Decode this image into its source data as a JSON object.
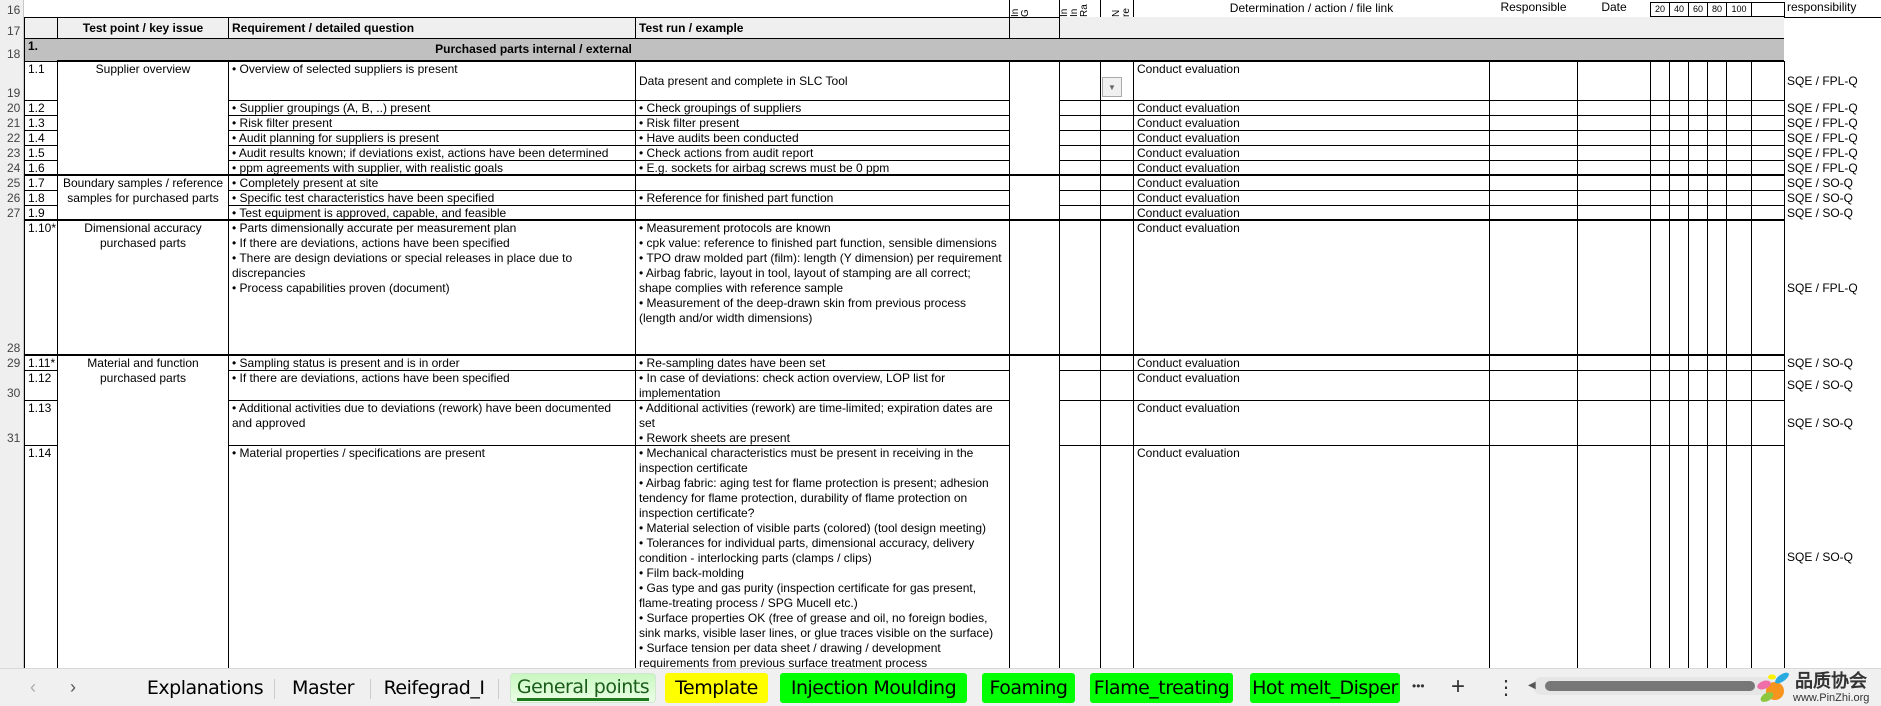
{
  "row_numbers": [
    "16",
    "17",
    "18",
    "19",
    "20",
    "21",
    "22",
    "23",
    "24",
    "25",
    "26",
    "27",
    "28",
    "29",
    "30",
    "31",
    ""
  ],
  "header": {
    "test_point": "Test point / key issue",
    "requirement": "Requirement / detailed question",
    "test_run": "Test run / example",
    "col_e": "In G",
    "col_f": "In In Ra",
    "col_g": "N re",
    "determination": "Determination / action / file link",
    "responsible": "Responsible",
    "date": "Date",
    "pct": [
      "20",
      "40",
      "60",
      "80",
      "100"
    ],
    "responsibility": "responsibility"
  },
  "section": {
    "number": "1.",
    "title": "Purchased parts internal / external"
  },
  "groups": {
    "g1": "Supplier overview",
    "g2": "Boundary samples / reference samples for purchased parts",
    "g3": "Dimensional accuracy purchased parts",
    "g4": "Material and function purchased parts"
  },
  "rows": [
    {
      "id": "1.1",
      "req": "• Overview of selected suppliers is present",
      "test": "Data present and complete in SLC Tool",
      "action": "Conduct evaluation",
      "resp": "SQE / FPL-Q"
    },
    {
      "id": "1.2",
      "req": "• Supplier groupings (A, B, ..) present",
      "test": "• Check groupings of suppliers",
      "action": "Conduct evaluation",
      "resp": "SQE / FPL-Q"
    },
    {
      "id": "1.3",
      "req": "• Risk filter present",
      "test": "• Risk filter present",
      "action": "Conduct evaluation",
      "resp": "SQE / FPL-Q"
    },
    {
      "id": "1.4",
      "req": "• Audit planning for suppliers is present",
      "test": "• Have audits been conducted",
      "action": "Conduct evaluation",
      "resp": "SQE / FPL-Q"
    },
    {
      "id": "1.5",
      "req": "• Audit results known; if deviations exist, actions have been determined",
      "test": "• Check actions from audit report",
      "action": "Conduct evaluation",
      "resp": "SQE / FPL-Q"
    },
    {
      "id": "1.6",
      "req": "• ppm agreements with supplier, with realistic goals",
      "test": "• E.g. sockets for airbag screws must be 0 ppm",
      "action": "Conduct evaluation",
      "resp": "SQE / FPL-Q"
    },
    {
      "id": "1.7",
      "req": "• Completely present at site",
      "test": "",
      "action": "Conduct evaluation",
      "resp": "SQE / SO-Q"
    },
    {
      "id": "1.8",
      "req": "• Specific test characteristics have been specified",
      "test": "• Reference for finished part function",
      "action": "Conduct evaluation",
      "resp": "SQE / SO-Q"
    },
    {
      "id": "1.9",
      "req": "• Test equipment is approved, capable, and feasible",
      "test": "",
      "action": "Conduct evaluation",
      "resp": "SQE / SO-Q"
    },
    {
      "id": "1.10*",
      "req": "• Parts dimensionally accurate per measurement plan\n• If there are deviations, actions have been specified\n• There are design deviations or special releases in place due to discrepancies\n• Process capabilities proven (document)",
      "test": "• Measurement protocols are known\n• cpk value: reference to finished part function,  sensible dimensions\n• TPO draw molded part (film): length (Y dimension) per requirement\n• Airbag fabric, layout in tool, layout of stamping are all correct; shape complies with reference sample\n• Measurement of the deep-drawn skin from previous process (length and/or width dimensions)",
      "action": "Conduct evaluation",
      "resp": "SQE / FPL-Q"
    },
    {
      "id": "1.11*",
      "req": "• Sampling status is present and is in order",
      "test": "• Re-sampling dates have been set",
      "action": "Conduct evaluation",
      "resp": "SQE / SO-Q"
    },
    {
      "id": "1.12",
      "req": "• If there are deviations, actions have been specified",
      "test": "• In case of deviations: check action overview, LOP list for implementation",
      "action": "Conduct evaluation",
      "resp": "SQE / SO-Q"
    },
    {
      "id": "1.13",
      "req": "• Additional activities due to deviations (rework) have been documented and approved",
      "test": "• Additional activities (rework) are time-limited; expiration dates are set\n• Rework sheets are present",
      "action": "Conduct evaluation",
      "resp": "SQE / SO-Q"
    },
    {
      "id": "1.14",
      "req": "• Material properties / specifications are present",
      "test": "• Mechanical characteristics must be present in receiving in the inspection certificate\n• Airbag fabric: aging test for flame protection is present; adhesion tendency for flame protection, durability of flame protection on inspection certificate?\n• Material selection of visible parts (colored)  (tool design meeting)\n• Tolerances for individual parts, dimensional accuracy, delivery condition - interlocking parts (clamps / clips)\n• Film back-molding\n• Gas type and gas purity  (inspection certificate for gas present, flame-treating process / SPG Mucell etc.)\n• Surface properties OK (free of grease and oil, no foreign bodies, sink marks, visible laser lines, or glue traces visible on the surface)\n• Surface tension per data sheet / drawing / development requirements from previous surface treatment process",
      "action": "Conduct evaluation",
      "resp": "SQE / SO-Q"
    }
  ],
  "tabs": [
    {
      "label": "Explanations",
      "color": ""
    },
    {
      "label": "Master",
      "color": ""
    },
    {
      "label": "Reifegrad_I",
      "color": ""
    },
    {
      "label": "General points",
      "color": "#c9f7c0",
      "active": true
    },
    {
      "label": "Template",
      "color": "#ffff00"
    },
    {
      "label": "Injection Moulding",
      "color": "#00ff00"
    },
    {
      "label": "Foaming",
      "color": "#00ff00"
    },
    {
      "label": "Flame_treating",
      "color": "#00ff00"
    },
    {
      "label": "Hot melt_Disper",
      "color": "#00ff00"
    }
  ],
  "tabbar": {
    "prev": "‹",
    "next": "›",
    "more": "•••",
    "add": "+",
    "menu": "⋮",
    "scroll_left": "◀"
  },
  "watermark": {
    "name": "品质协会",
    "url": "www.PinZhi.org"
  }
}
